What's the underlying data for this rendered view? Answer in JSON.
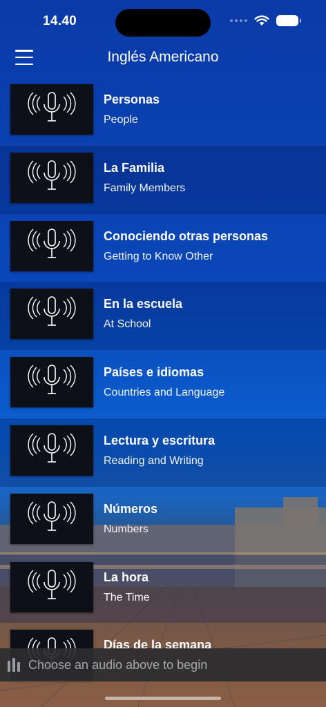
{
  "status_bar": {
    "time": "14.40",
    "icons": [
      "cellular-dots-icon",
      "wifi-icon",
      "battery-icon"
    ]
  },
  "nav": {
    "menu_icon": "hamburger-menu-icon",
    "title": "Inglés Americano"
  },
  "lessons": [
    {
      "title": "Personas",
      "subtitle": "People",
      "icon": "microphone-icon"
    },
    {
      "title": "La Familia",
      "subtitle": "Family Members",
      "icon": "microphone-icon"
    },
    {
      "title": "Conociendo otras personas",
      "subtitle": "Getting to Know Other",
      "icon": "microphone-icon"
    },
    {
      "title": "En la escuela",
      "subtitle": "At School",
      "icon": "microphone-icon"
    },
    {
      "title": "Países e idiomas",
      "subtitle": "Countries and Language",
      "icon": "microphone-icon"
    },
    {
      "title": "Lectura y escritura",
      "subtitle": "Reading and Writing",
      "icon": "microphone-icon"
    },
    {
      "title": "Números",
      "subtitle": "Numbers",
      "icon": "microphone-icon"
    },
    {
      "title": "La hora",
      "subtitle": "The Time",
      "icon": "microphone-icon"
    },
    {
      "title": "Días de la semana",
      "subtitle": "",
      "icon": "microphone-icon"
    }
  ],
  "player": {
    "icon": "audio-bars-icon",
    "text": "Choose an audio above to begin"
  },
  "colors": {
    "background_top": "#0a3aa8",
    "thumbnail": "#0d1117",
    "player_bar": "#2d2d30"
  }
}
